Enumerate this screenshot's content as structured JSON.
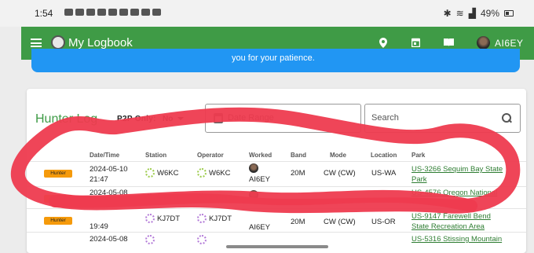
{
  "status_bar": {
    "time": "1:54",
    "battery": "49%"
  },
  "app_bar": {
    "title": "My Logbook",
    "callsign": "AI6EY",
    "icons": [
      "menu-icon",
      "location-icon",
      "calendar-icon",
      "book-icon"
    ]
  },
  "banner": {
    "text": "you for your patience."
  },
  "hunter_log": {
    "title": "Hunter Log",
    "p2p_label": "P2P Only:",
    "p2p_value": "No",
    "date_range_label": "Date Range",
    "search_label": "Search"
  },
  "table": {
    "headers": [
      "Date/Time",
      "Station",
      "Operator",
      "Worked",
      "Band",
      "Mode",
      "Location",
      "Park"
    ],
    "rows": [
      {
        "badge": "Hunter",
        "date": "2024-05-10",
        "time": "21:47",
        "station": "W6KC",
        "operator": "W6KC",
        "worked": "AI6EY",
        "band": "20M",
        "mode": "CW (CW)",
        "location": "US-WA",
        "park": "US-3266 Sequim Bay State Park"
      },
      {
        "badge": "Hunter",
        "date": "2024-05-08",
        "time": "",
        "station": "KJ7DT",
        "operator": "KJ7DT",
        "worked": "",
        "band": "",
        "mode": "",
        "location": "",
        "park": "US-4576 Oregon National"
      },
      {
        "badge": "Hunter",
        "date": "",
        "time": "19:49",
        "station": "KJ7DT",
        "operator": "KJ7DT",
        "worked": "AI6EY",
        "band": "20M",
        "mode": "CW (CW)",
        "location": "US-OR",
        "park": "US-9147 Farewell Bend State Recreation Area"
      },
      {
        "badge": "",
        "date": "2024-05-08",
        "time": "",
        "station": "",
        "operator": "",
        "worked": "",
        "band": "",
        "mode": "",
        "location": "",
        "park": "US-5316 Stissing Mountain"
      }
    ]
  },
  "colors": {
    "app_bar": "#3f9b46",
    "banner": "#2196f3",
    "badge": "#f59a0b",
    "annotation": "#ee3b4f",
    "link": "#2e7d32"
  }
}
